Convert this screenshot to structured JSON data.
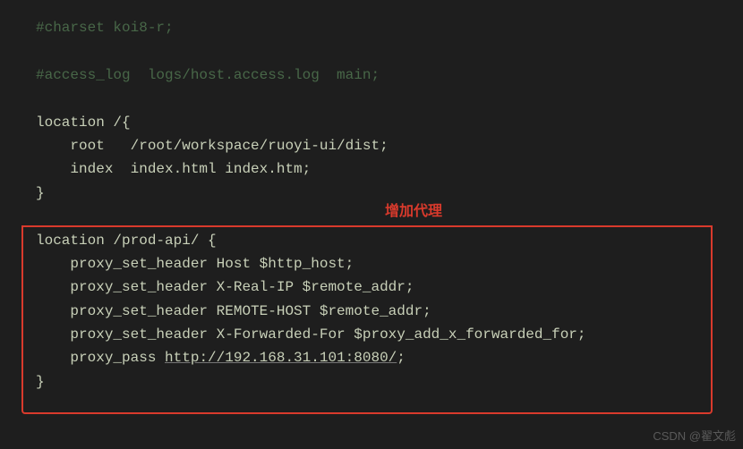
{
  "code": {
    "l1": "#charset koi8-r;",
    "l2": "",
    "l3a": "#access_log  logs/host.access.log  main",
    "l3b": ";",
    "l5_loc": "location",
    "l5_path": " /",
    "l5_brace": "{",
    "l6_pipe": "    ",
    "l6_dir": "root   /root/workspace/ruoyi-ui/dist",
    "l6_semi": ";",
    "l7_pipe": "    ",
    "l7_dir": "index  index.html index.htm",
    "l7_semi": ";",
    "l8_brace": "}",
    "l10_loc": "location",
    "l10_path": " /prod-api/ ",
    "l10_brace": "{",
    "l11_pipe": "    ",
    "l11_dir": "proxy_set_header Host $http_host",
    "l11_semi": ";",
    "l12_pipe": "    ",
    "l12_dir": "proxy_set_header X-Real-IP $remote_addr",
    "l12_semi": ";",
    "l13_pipe": "    ",
    "l13_dir": "proxy_set_header REMOTE-HOST $remote_addr",
    "l13_semi": ";",
    "l14_pipe": "    ",
    "l14_dir": "proxy_set_header X-Forwarded-For $proxy_add_x_forwarded_for",
    "l14_semi": ";",
    "l15_pipe": "    ",
    "l15_dir": "proxy_pass ",
    "l15_url": "http://192.168.31.101:8080/",
    "l15_semi": ";",
    "l16_brace": "}"
  },
  "annotation": "增加代理",
  "watermark": "CSDN @翟文彪"
}
